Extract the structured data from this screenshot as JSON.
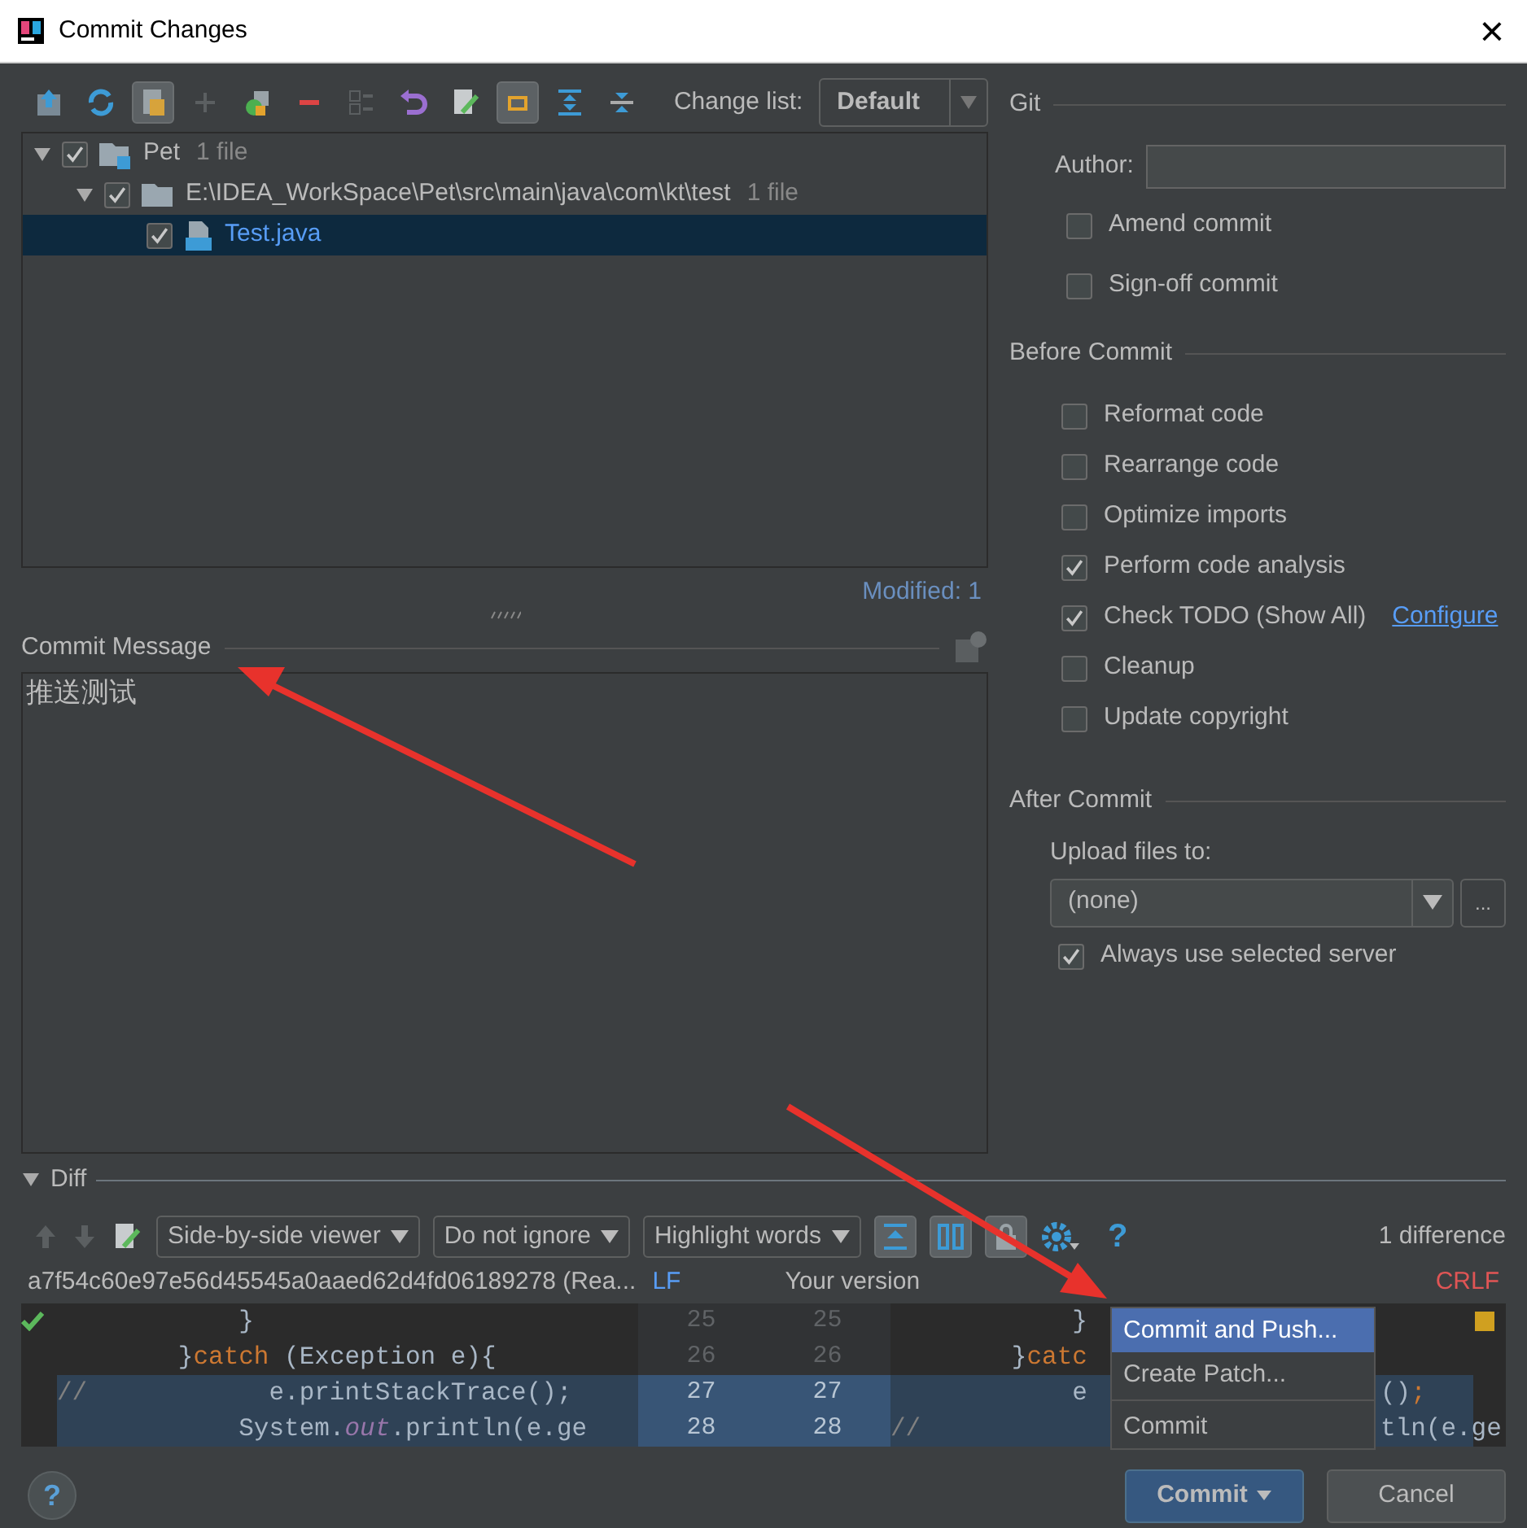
{
  "window": {
    "title": "Commit Changes",
    "close": "×"
  },
  "changes": {
    "change_list_label": "Change list:",
    "change_list": "Default",
    "status": "Modified: 1",
    "tree": [
      {
        "name": "Pet",
        "count": "1 file",
        "kind": "module",
        "expanded": true,
        "checked": true,
        "selected": false,
        "children": [
          {
            "name": "E:\\IDEA_WorkSpace\\Pet\\src\\main\\java\\com\\kt\\test",
            "count": "1 file",
            "kind": "folder",
            "expanded": true,
            "checked": true,
            "selected": false,
            "children": [
              {
                "name": "Test.java",
                "kind": "file",
                "checked": true,
                "selected": true
              }
            ]
          }
        ]
      }
    ]
  },
  "commit_message": {
    "label": "Commit Message",
    "value": "推送测试"
  },
  "git": {
    "title": "Git",
    "author_label": "Author:",
    "options": [
      {
        "label": "Amend commit",
        "checked": false
      },
      {
        "label": "Sign-off commit",
        "checked": false
      }
    ]
  },
  "before_commit": {
    "title": "Before Commit",
    "options": [
      {
        "label": "Reformat code",
        "checked": false
      },
      {
        "label": "Rearrange code",
        "checked": false
      },
      {
        "label": "Optimize imports",
        "checked": false
      },
      {
        "label": "Perform code analysis",
        "checked": true
      },
      {
        "label": "Check TODO (Show All)",
        "checked": true,
        "link": "Configure"
      },
      {
        "label": "Cleanup",
        "checked": false
      },
      {
        "label": "Update copyright",
        "checked": false
      }
    ]
  },
  "after_commit": {
    "title": "After Commit",
    "upload_label": "Upload files to:",
    "upload_target": "(none)",
    "more_button": "...",
    "options": [
      {
        "label": "Always use selected server",
        "checked": true
      }
    ]
  },
  "diff": {
    "title": "Diff",
    "expanded": true,
    "viewer": "Side-by-side viewer",
    "ignore": "Do not ignore",
    "highlight": "Highlight words",
    "help": "?",
    "summary": "1 difference",
    "left_title": "a7f54c60e97e56d45545a0aaed62d4fd06189278 (Rea...",
    "left_separator": "LF",
    "right_title": "Your version",
    "right_separator": "CRLF",
    "lines": [
      {
        "left_number": "25",
        "right_number": "25",
        "kind": "same",
        "left": [
          {
            "text": "            }",
            "kind": "plain"
          }
        ],
        "right_start": [
          {
            "text": "            }",
            "kind": "plain"
          }
        ]
      },
      {
        "left_number": "26",
        "right_number": "26",
        "kind": "same",
        "left": [
          {
            "text": "        }",
            "kind": "plain"
          },
          {
            "text": "catch",
            "kind": "keyword"
          },
          {
            "text": " (Exception e){",
            "kind": "plain"
          }
        ],
        "right_start": [
          {
            "text": "        }",
            "kind": "plain"
          },
          {
            "text": "catc",
            "kind": "keyword"
          }
        ]
      },
      {
        "left_number": "27",
        "right_number": "27",
        "kind": "changed",
        "left": [
          {
            "text": "//",
            "kind": "comment"
          },
          {
            "text": "            e.printStackTrace();",
            "kind": "plain"
          }
        ],
        "right_start": [
          {
            "text": "            e",
            "kind": "plain"
          }
        ],
        "right_end": [
          {
            "text": "()",
            "kind": "plain"
          },
          {
            "text": ";",
            "kind": "keyword"
          }
        ]
      },
      {
        "left_number": "28",
        "right_number": "28",
        "kind": "changed",
        "left": [
          {
            "text": "            System.",
            "kind": "plain"
          },
          {
            "text": "out",
            "kind": "field"
          },
          {
            "text": ".println(e.ge",
            "kind": "plain"
          }
        ],
        "right_start": [
          {
            "text": "//",
            "kind": "comment"
          }
        ],
        "right_end": [
          {
            "text": "tln(e.ge",
            "kind": "plain"
          }
        ]
      }
    ]
  },
  "context_menu": {
    "items": [
      {
        "label": "Commit and Push...",
        "selected": true
      },
      {
        "label": "Create Patch...",
        "selected": false
      },
      {
        "label": "Commit",
        "selected": false
      }
    ]
  },
  "buttons": {
    "help": "?",
    "commit": "Commit",
    "cancel": "Cancel"
  }
}
